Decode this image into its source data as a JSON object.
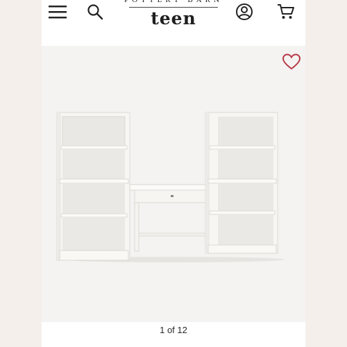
{
  "header": {
    "brand_top": "POTTERY BARN",
    "brand": "teen",
    "icons": {
      "menu": "menu-icon",
      "search": "search-icon",
      "account": "account-icon",
      "cart": "cart-icon"
    }
  },
  "gallery": {
    "image_alt": "white bookcases with desk",
    "counter": "1 of 12",
    "favorite_icon": "heart-icon",
    "accent_color": "#b73a4a"
  }
}
